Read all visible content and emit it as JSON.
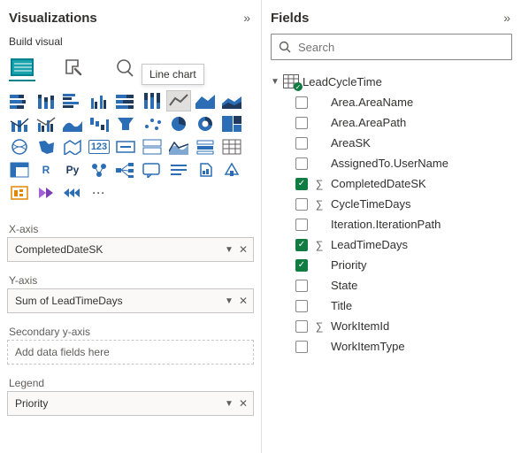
{
  "viz": {
    "title": "Visualizations",
    "subhead": "Build visual",
    "tooltip": "Line chart",
    "gallery_icons": [
      "stacked-bar",
      "stacked-column",
      "clustered-bar",
      "clustered-column",
      "100-stacked-bar",
      "100-stacked-column",
      "line-chart",
      "area-chart",
      "stacked-area",
      "line-stacked-column",
      "line-clustered-column",
      "ribbon-chart",
      "waterfall",
      "funnel",
      "scatter",
      "pie",
      "donut",
      "treemap",
      "map",
      "filled-map",
      "azure-map",
      "gauge",
      "card",
      "multi-row-card",
      "kpi",
      "slicer",
      "table",
      "matrix",
      "r-visual",
      "py-visual",
      "key-influencers",
      "decomposition-tree",
      "qa",
      "smart-narrative",
      "paginated",
      "metrics",
      "power-apps",
      "power-automate",
      "get-more",
      "more-options"
    ],
    "wells": {
      "xaxis_label": "X-axis",
      "xaxis_value": "CompletedDateSK",
      "yaxis_label": "Y-axis",
      "yaxis_value": "Sum of LeadTimeDays",
      "sec_yaxis_label": "Secondary y-axis",
      "sec_yaxis_placeholder": "Add data fields here",
      "legend_label": "Legend",
      "legend_value": "Priority"
    }
  },
  "fields": {
    "title": "Fields",
    "search_placeholder": "Search",
    "table": "LeadCycleTime",
    "items": [
      {
        "label": "Area.AreaName",
        "checked": false,
        "sigma": false
      },
      {
        "label": "Area.AreaPath",
        "checked": false,
        "sigma": false
      },
      {
        "label": "AreaSK",
        "checked": false,
        "sigma": false
      },
      {
        "label": "AssignedTo.UserName",
        "checked": false,
        "sigma": false
      },
      {
        "label": "CompletedDateSK",
        "checked": true,
        "sigma": true
      },
      {
        "label": "CycleTimeDays",
        "checked": false,
        "sigma": true
      },
      {
        "label": "Iteration.IterationPath",
        "checked": false,
        "sigma": false
      },
      {
        "label": "LeadTimeDays",
        "checked": true,
        "sigma": true
      },
      {
        "label": "Priority",
        "checked": true,
        "sigma": false
      },
      {
        "label": "State",
        "checked": false,
        "sigma": false
      },
      {
        "label": "Title",
        "checked": false,
        "sigma": false
      },
      {
        "label": "WorkItemId",
        "checked": false,
        "sigma": true
      },
      {
        "label": "WorkItemType",
        "checked": false,
        "sigma": false
      }
    ]
  }
}
